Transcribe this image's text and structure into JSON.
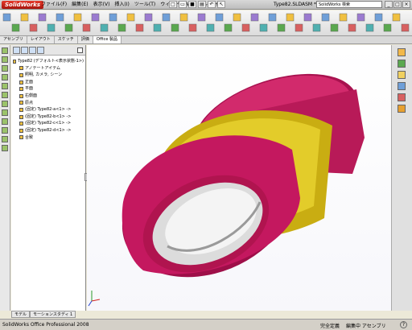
{
  "app": {
    "logo": "SolidWorks",
    "document_title": "Type82.SLDASM *"
  },
  "menu": [
    "ファイル(F)",
    "編集(E)",
    "表示(V)",
    "挿入(I)",
    "ツール(T)",
    "ウィンドウ(W)",
    "ヘルプ(H)"
  ],
  "search": {
    "placeholder": "SolidWorks 検索"
  },
  "command_tabs": [
    "アセンブリ",
    "レイアウト",
    "スケッチ",
    "評価",
    "Office 製品"
  ],
  "tree": {
    "root": "Type82 (デフォルト<表示状態-1>)",
    "items": [
      "アノテートアイテム",
      "照明, カメラ, シーン",
      "正面",
      "平面",
      "右側面",
      "原点",
      "(固定) Type82-a<1> ->",
      "(固定) Type82-b<1> ->",
      "(固定) Type82-c<1> ->",
      "(固定) Type82-d<1> ->",
      "合致"
    ]
  },
  "bottom_tabs": [
    "モデル",
    "モーションスタディ 1"
  ],
  "status": {
    "left": "SolidWorks Office Professional 2008",
    "state1": "完全定義",
    "state2": "編集中 アセンブリ"
  },
  "colors": {
    "ring_magenta": "#c4185f",
    "ring_gold": "#d8c21a",
    "inner_silver": "#cfcfcf"
  }
}
